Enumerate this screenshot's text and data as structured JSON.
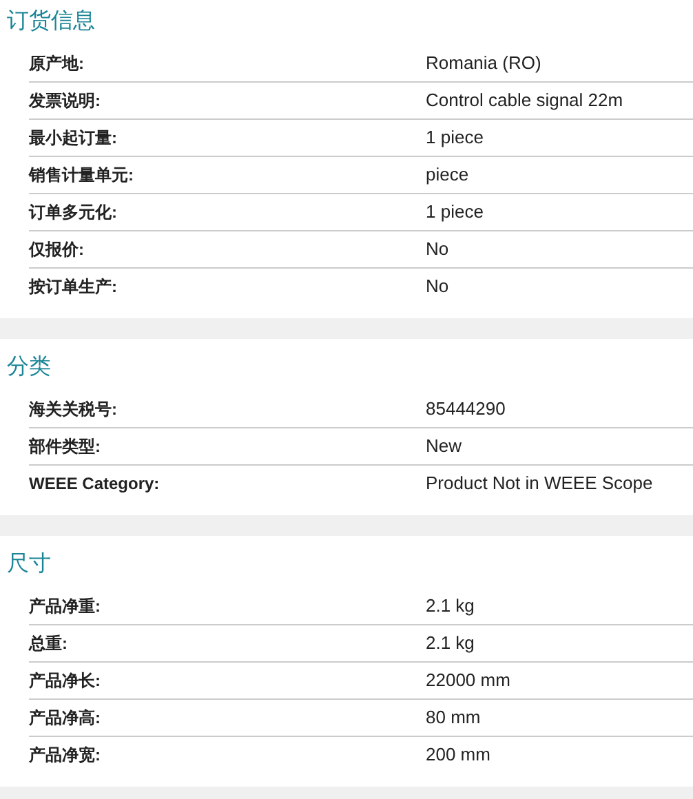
{
  "sections": [
    {
      "title": "订货信息",
      "rows": [
        {
          "label": "原产地:",
          "value": "Romania (RO)"
        },
        {
          "label": "发票说明:",
          "value": "Control cable signal 22m"
        },
        {
          "label": "最小起订量:",
          "value": "1 piece"
        },
        {
          "label": "销售计量单元:",
          "value": "piece"
        },
        {
          "label": "订单多元化:",
          "value": "1 piece"
        },
        {
          "label": "仅报价:",
          "value": "No"
        },
        {
          "label": "按订单生产:",
          "value": "No"
        }
      ]
    },
    {
      "title": "分类",
      "rows": [
        {
          "label": "海关关税号:",
          "value": "85444290"
        },
        {
          "label": "部件类型:",
          "value": "New"
        },
        {
          "label": "WEEE Category:",
          "value": "Product Not in WEEE Scope"
        }
      ]
    },
    {
      "title": "尺寸",
      "rows": [
        {
          "label": "产品净重:",
          "value": "2.1 kg"
        },
        {
          "label": "总重:",
          "value": "2.1 kg"
        },
        {
          "label": "产品净长:",
          "value": "22000 mm"
        },
        {
          "label": "产品净高:",
          "value": "80 mm"
        },
        {
          "label": "产品净宽:",
          "value": "200 mm"
        }
      ]
    }
  ]
}
